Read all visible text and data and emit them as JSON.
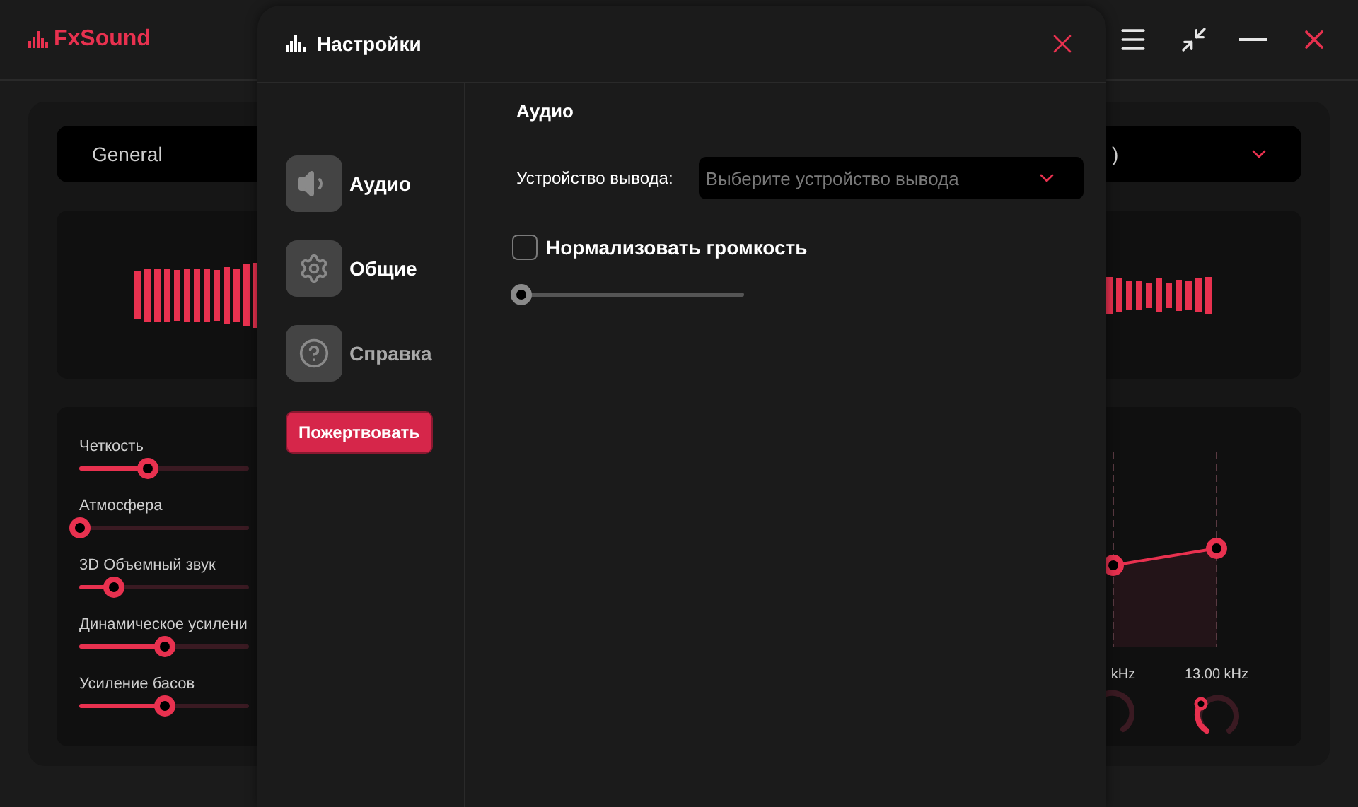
{
  "app": {
    "logo": "FxSound",
    "preset_left": "General",
    "preset_right": ")"
  },
  "effects": [
    {
      "label": "Четкость",
      "level": 0.4
    },
    {
      "label": "Атмосфера",
      "level": 0
    },
    {
      "label": "3D Объемный звук",
      "level": 0.2
    },
    {
      "label": "Динамическое усилени",
      "level": 0.5
    },
    {
      "label": "Усиление басов",
      "level": 0.5
    }
  ],
  "eq": {
    "bands": [
      {
        "label": "kHz"
      },
      {
        "label": "13.00 kHz"
      }
    ]
  },
  "dialog": {
    "title": "Настройки",
    "nav": [
      {
        "label": "Аудио",
        "kind": "speaker",
        "dimmed": false
      },
      {
        "label": "Общие",
        "kind": "gear",
        "dimmed": false
      },
      {
        "label": "Справка",
        "kind": "help",
        "dimmed": true
      }
    ],
    "donate": "Пожертвовать",
    "section": "Аудио",
    "device_label": "Устройство вывода:",
    "device_placeholder": "Выберите устройство вывода",
    "normalize": {
      "label": "Нормализовать громкость",
      "checked": false,
      "level": 0
    }
  }
}
